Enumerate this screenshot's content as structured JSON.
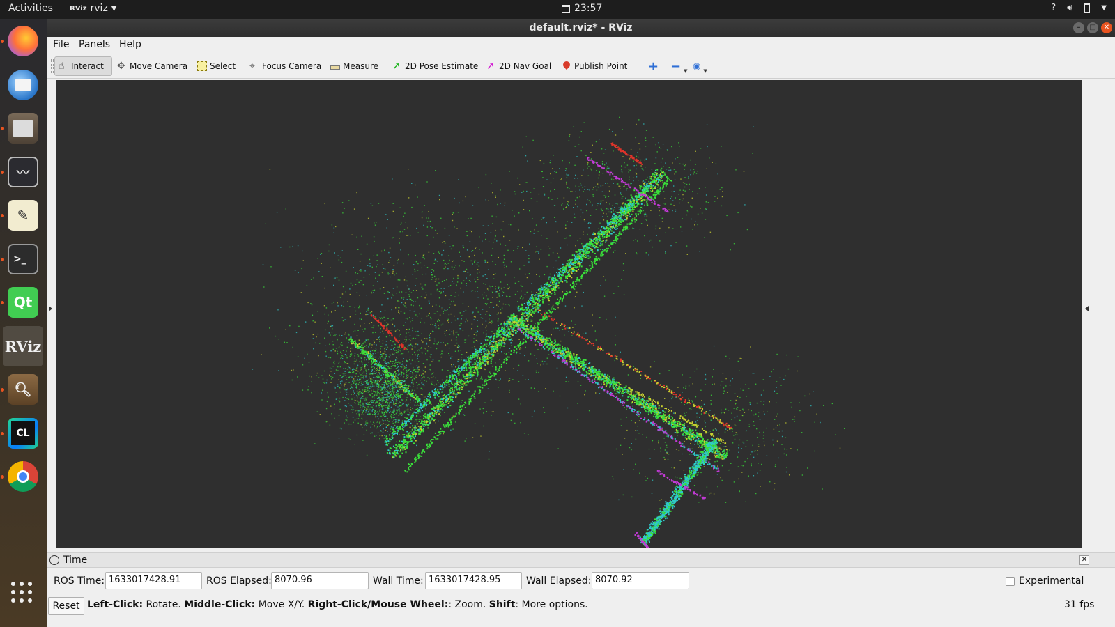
{
  "topbar": {
    "activities": "Activities",
    "app_name": "rviz",
    "app_badge": "RViz",
    "clock": "23:57"
  },
  "dock": {
    "apps": [
      {
        "name": "firefox-icon",
        "color": "#e66000"
      },
      {
        "name": "thunderbird-icon",
        "color": "#2a76c9"
      },
      {
        "name": "files-icon",
        "color": "#6a5a48"
      },
      {
        "name": "system-monitor-icon",
        "color": "#2b2b2b"
      },
      {
        "name": "text-editor-icon",
        "color": "#f0e8c8"
      },
      {
        "name": "terminal-icon",
        "color": "#2a2a2a"
      },
      {
        "name": "qt-creator-icon",
        "color": "#41cd52",
        "text": "Qt"
      },
      {
        "name": "rviz-icon",
        "text": "RViz"
      },
      {
        "name": "document-viewer-icon",
        "color": "#7b5a38"
      },
      {
        "name": "clion-icon",
        "color": "#111",
        "text": "CL"
      },
      {
        "name": "chrome-icon",
        "color": "#dd4b39"
      }
    ]
  },
  "window": {
    "title": "default.rviz* - RViz"
  },
  "menu": {
    "file": "File",
    "panels": "Panels",
    "help": "Help"
  },
  "toolbar": {
    "interact": "Interact",
    "move_camera": "Move Camera",
    "select": "Select",
    "focus_camera": "Focus Camera",
    "measure": "Measure",
    "pose_estimate": "2D Pose Estimate",
    "nav_goal": "2D Nav Goal",
    "publish_point": "Publish Point"
  },
  "time_panel": {
    "title": "Time",
    "ros_time_label": "ROS Time:",
    "ros_time": "1633017428.91",
    "ros_elapsed_label": "ROS Elapsed:",
    "ros_elapsed": "8070.96",
    "wall_time_label": "Wall Time:",
    "wall_time": "1633017428.95",
    "wall_elapsed_label": "Wall Elapsed:",
    "wall_elapsed": "8070.92",
    "experimental": "Experimental"
  },
  "status": {
    "reset": "Reset",
    "left_click": "Left-Click:",
    "left_click_action": " Rotate. ",
    "middle_click": "Middle-Click:",
    "middle_click_action": " Move X/Y. ",
    "right_click": "Right-Click/Mouse Wheel:",
    "right_click_action": ": Zoom. ",
    "shift": "Shift",
    "shift_action": ": More options.",
    "fps": "31 fps"
  },
  "colors": {
    "accent": "#e95420",
    "viewport_bg": "#2f2f2f",
    "cloud_green": "#3adf3a",
    "cloud_cyan": "#2fc9c9",
    "cloud_magenta": "#c23ad6",
    "cloud_red": "#e0342a",
    "cloud_yellow": "#c8d030"
  }
}
